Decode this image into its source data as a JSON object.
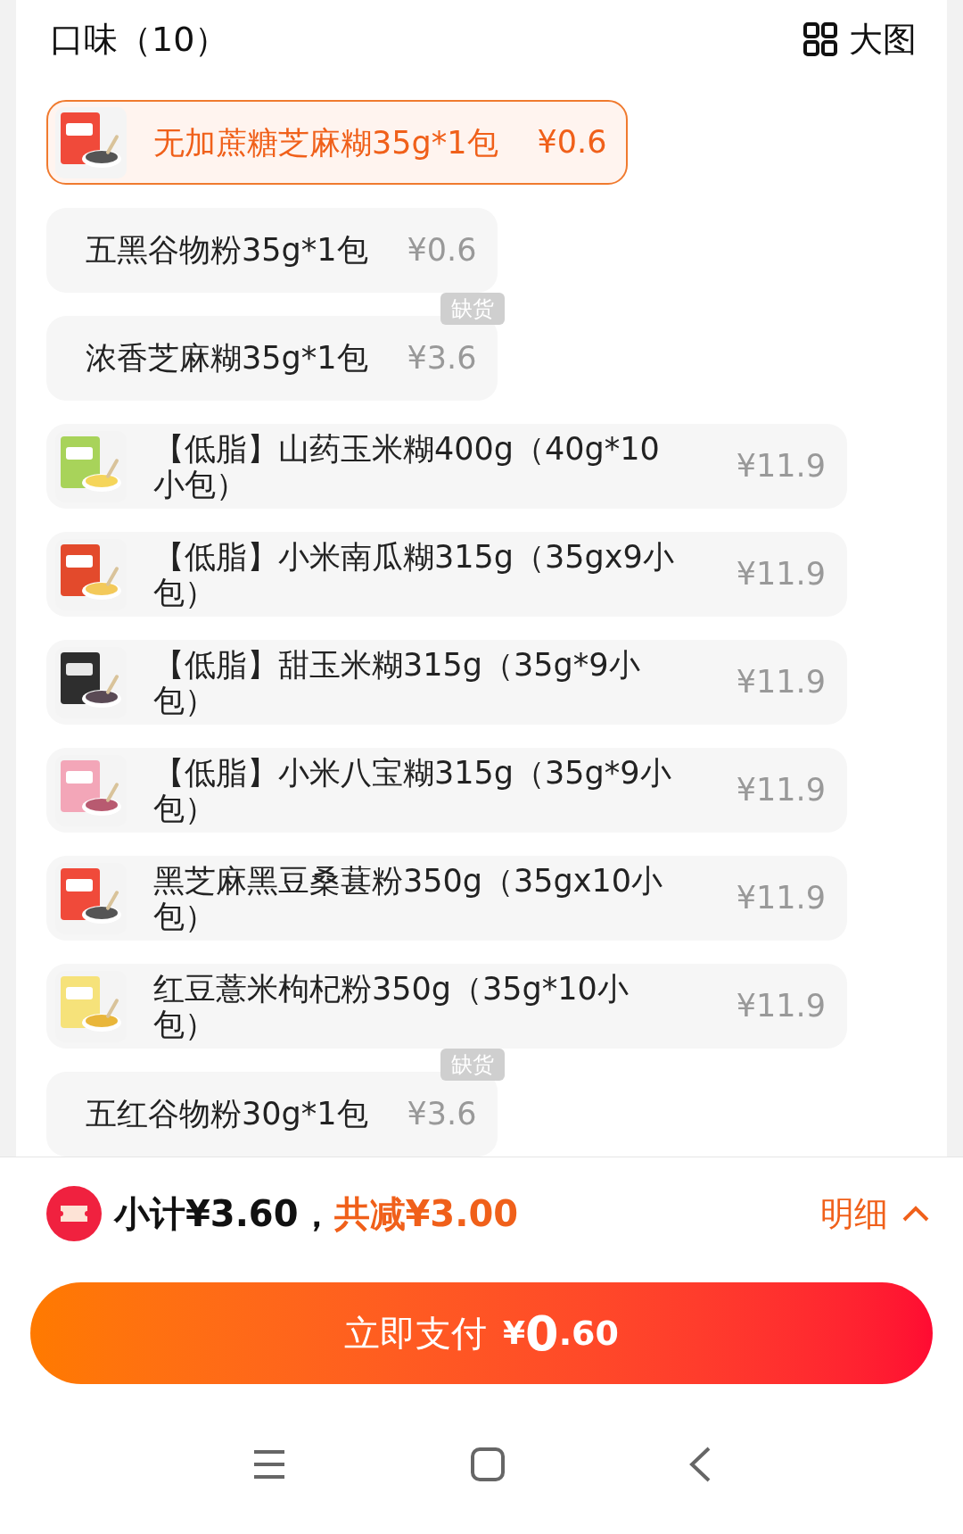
{
  "header": {
    "title": "口味（10）",
    "view_toggle": "大图"
  },
  "options": [
    {
      "name": "无加蔗糖芝麻糊35g*1包",
      "price": "¥0.6",
      "selected": true
    },
    {
      "kind": "text",
      "name": "五黑谷物粉35g*1包",
      "price": "¥0.6",
      "selected": false
    },
    {
      "kind": "text",
      "name": "浓香芝麻糊35g*1包",
      "price": "¥3.6",
      "selected": false,
      "tag": "缺货"
    },
    {
      "name": "【低脂】山药玉米糊400g（40g*10小包）",
      "price": "¥11.9",
      "selected": false
    },
    {
      "name": "【低脂】小米南瓜糊315g（35gx9小包）",
      "price": "¥11.9",
      "selected": false
    },
    {
      "name": "【低脂】甜玉米糊315g（35g*9小包）",
      "price": "¥11.9",
      "selected": false
    },
    {
      "name": "【低脂】小米八宝糊315g（35g*9小包）",
      "price": "¥11.9",
      "selected": false
    },
    {
      "name": "黑芝麻黑豆桑葚粉350g（35gx10小包）",
      "price": "¥11.9",
      "selected": false
    },
    {
      "name": "红豆薏米枸杞粉350g（35g*10小包）",
      "price": "¥11.9",
      "selected": false
    },
    {
      "kind": "text",
      "name": "五红谷物粉30g*1包",
      "price": "¥3.6",
      "selected": false,
      "tag": "缺货"
    }
  ],
  "summary": {
    "subtotal": "小计¥3.60，",
    "discount": "共减¥3.00",
    "details": "明细"
  },
  "pay_button": {
    "label": "立即支付",
    "currency": "¥",
    "integer": "0",
    "decimal": ".60"
  }
}
